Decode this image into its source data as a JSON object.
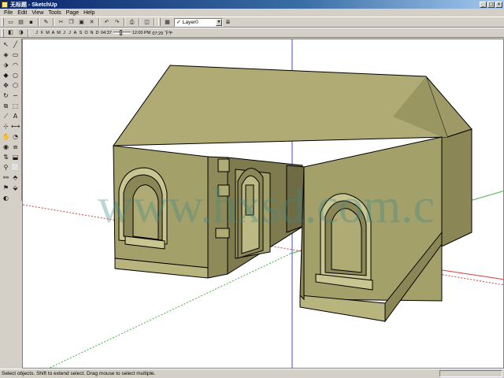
{
  "window": {
    "title": "无标题 - SketchUp",
    "buttons": {
      "minimize": "_",
      "maximize": "□",
      "close": "×"
    }
  },
  "menu": {
    "items": [
      "File",
      "Edit",
      "View",
      "Tools",
      "Page",
      "Help"
    ]
  },
  "toolbar": {
    "layer_label": "Layer0",
    "layer_checkmark": "✓"
  },
  "shadow": {
    "months": [
      "J",
      "F",
      "M",
      "A",
      "M",
      "J",
      "J",
      "A",
      "S",
      "O",
      "N",
      "D"
    ],
    "time_start": "04:37",
    "time_mid": "12:00 PM",
    "time_end": "07:29 下午"
  },
  "viewport": {
    "watermark": "www.hxsd.com.c"
  },
  "status": {
    "text": "Select objects. Shift to extend select. Drag mouse to select multiple."
  },
  "colors": {
    "wall": "#a4a06a",
    "roof": "#b0ab74",
    "wall_dark": "#8a8656",
    "axis_red": "#d04040",
    "axis_green": "#40b040",
    "axis_blue": "#4040d0"
  }
}
